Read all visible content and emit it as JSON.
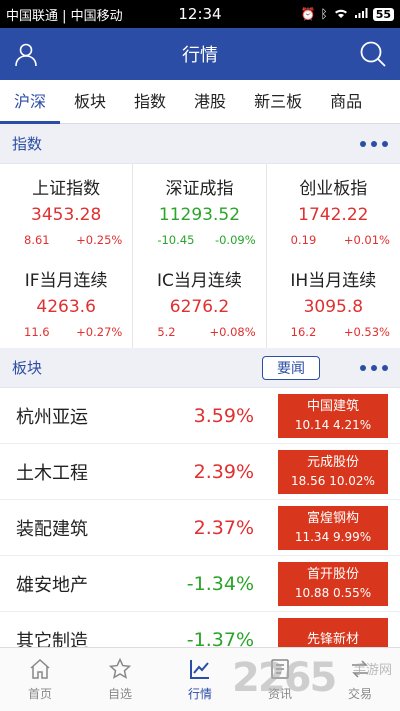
{
  "status_bar": {
    "carrier": "中国联通 | 中国移动",
    "time": "12:34",
    "battery": "55"
  },
  "header": {
    "title": "行情"
  },
  "tabs": [
    {
      "label": "沪深",
      "active": true
    },
    {
      "label": "板块",
      "active": false
    },
    {
      "label": "指数",
      "active": false
    },
    {
      "label": "港股",
      "active": false
    },
    {
      "label": "新三板",
      "active": false
    },
    {
      "label": "商品",
      "active": false
    }
  ],
  "index_section": {
    "label": "指数",
    "items": [
      {
        "name": "上证指数",
        "value": "3453.28",
        "change": "8.61",
        "pct": "+0.25%",
        "dir": "up"
      },
      {
        "name": "深证成指",
        "value": "11293.52",
        "change": "-10.45",
        "pct": "-0.09%",
        "dir": "down"
      },
      {
        "name": "创业板指",
        "value": "1742.22",
        "change": "0.19",
        "pct": "+0.01%",
        "dir": "up"
      },
      {
        "name": "IF当月连续",
        "value": "4263.6",
        "change": "11.6",
        "pct": "+0.27%",
        "dir": "up"
      },
      {
        "name": "IC当月连续",
        "value": "6276.2",
        "change": "5.2",
        "pct": "+0.08%",
        "dir": "up"
      },
      {
        "name": "IH当月连续",
        "value": "3095.8",
        "change": "16.2",
        "pct": "+0.53%",
        "dir": "up"
      }
    ]
  },
  "sector_section": {
    "label": "板块",
    "news_button": "要闻",
    "rows": [
      {
        "name": "杭州亚运",
        "pct": "3.59%",
        "dir": "up",
        "stock_name": "中国建筑",
        "stock_detail": "10.14 4.21%"
      },
      {
        "name": "土木工程",
        "pct": "2.39%",
        "dir": "up",
        "stock_name": "元成股份",
        "stock_detail": "18.56 10.02%"
      },
      {
        "name": "装配建筑",
        "pct": "2.37%",
        "dir": "up",
        "stock_name": "富煌钢构",
        "stock_detail": "11.34 9.99%"
      },
      {
        "name": "雄安地产",
        "pct": "-1.34%",
        "dir": "down",
        "stock_name": "首开股份",
        "stock_detail": "10.88 0.55%"
      },
      {
        "name": "其它制造",
        "pct": "-1.37%",
        "dir": "down",
        "stock_name": "先锋新材",
        "stock_detail": ""
      }
    ]
  },
  "bottom_nav": [
    {
      "label": "首页",
      "icon": "home-icon",
      "active": false
    },
    {
      "label": "自选",
      "icon": "star-icon",
      "active": false
    },
    {
      "label": "行情",
      "icon": "chart-icon",
      "active": true
    },
    {
      "label": "资讯",
      "icon": "news-icon",
      "active": false
    },
    {
      "label": "交易",
      "icon": "trade-icon",
      "active": false
    }
  ],
  "watermark": {
    "big": "2265",
    "small": "手游网",
    "suffix": ".com"
  },
  "colors": {
    "primary": "#2c4da5",
    "up": "#e03030",
    "down": "#2aa52a",
    "stock_bg": "#d8371d"
  }
}
